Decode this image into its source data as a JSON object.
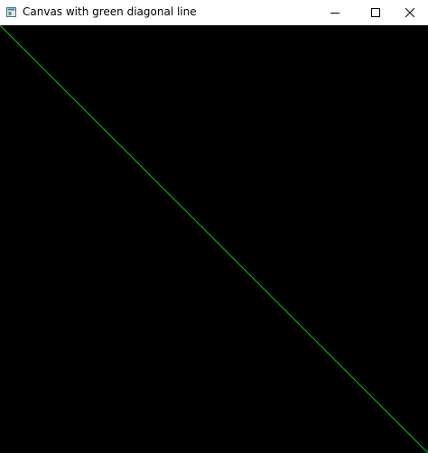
{
  "window": {
    "title": "Canvas with green diagonal line",
    "controls": {
      "minimize": "minimize",
      "maximize": "maximize",
      "close": "close"
    }
  },
  "canvas": {
    "background_color": "#000000",
    "line_color": "#00c800",
    "line": {
      "from": "top-left",
      "to": "bottom-right"
    }
  },
  "icons": {
    "app": "app-window-icon",
    "minimize": "minimize-icon",
    "maximize": "maximize-icon",
    "close": "close-icon"
  }
}
